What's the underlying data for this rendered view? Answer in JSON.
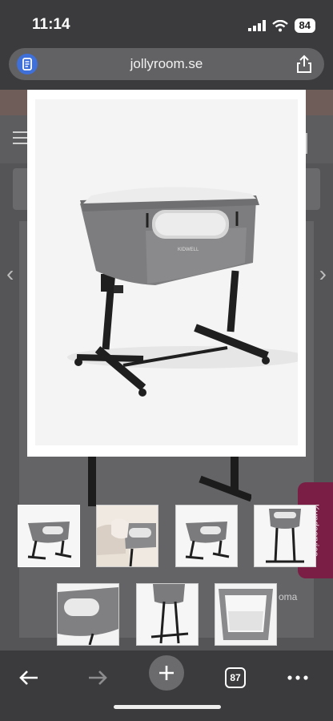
{
  "status_bar": {
    "time": "11:14",
    "battery": "84"
  },
  "browser": {
    "url": "jollyroom.se"
  },
  "side_tab": {
    "label": "Kundservice"
  },
  "peek_text": "oma",
  "product": {
    "brand_label": "KIDWELL"
  },
  "gallery": {
    "thumbnails": [
      {
        "name": "bedside-crib-side"
      },
      {
        "name": "bedside-crib-bedroom"
      },
      {
        "name": "bedside-crib-side-2"
      },
      {
        "name": "bedside-crib-front"
      },
      {
        "name": "bedside-crib-closeup"
      },
      {
        "name": "bedside-crib-legs"
      },
      {
        "name": "bedside-crib-interior"
      }
    ]
  },
  "toolbar": {
    "tab_count": "87"
  },
  "icons": {
    "reader": "reader-mode-icon",
    "share": "share-icon",
    "back": "back-arrow-icon",
    "forward": "forward-arrow-icon",
    "new_tab": "plus-icon",
    "tabs": "tabs-icon",
    "more": "more-icon"
  },
  "colors": {
    "side_tab": "#7a1e45",
    "background": "#3b3b3d",
    "lightbox": "#ffffff"
  }
}
